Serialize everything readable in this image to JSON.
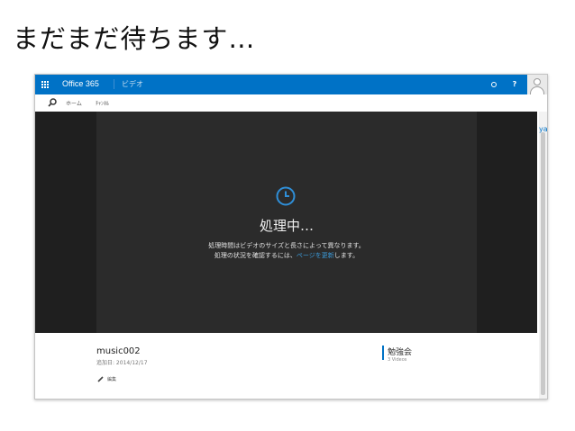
{
  "slide": {
    "title": "まだまだ待ちます…"
  },
  "o365": {
    "brand": "Office 365",
    "app": "ビデオ",
    "help": "?"
  },
  "nav": {
    "home": "ホーム",
    "channel": "ﾁｬﾝﾈﾙ"
  },
  "processing": {
    "title": "処理中…",
    "line1": "処理時間はビデオのサイズと長さによって異なります。",
    "line2_before": "処理の状況を確認するには、",
    "line2_link": "ページを更新",
    "line2_after": "します。"
  },
  "right_edge": {
    "text": "ya"
  },
  "video": {
    "title": "music002",
    "date": "追加日: 2014/12/17",
    "edit": "編集"
  },
  "channel": {
    "name": "勉強会",
    "count": "3 Videos"
  },
  "colors": {
    "suite_bar": "#0072c6",
    "stage": "#1f1f1f",
    "player": "#2b2b2b",
    "link": "#3b9ad9",
    "accent": "#0072c6"
  },
  "icons": [
    "app-launcher-icon",
    "gear-icon",
    "help-icon",
    "avatar",
    "search-icon",
    "clock-icon",
    "pencil-icon"
  ]
}
